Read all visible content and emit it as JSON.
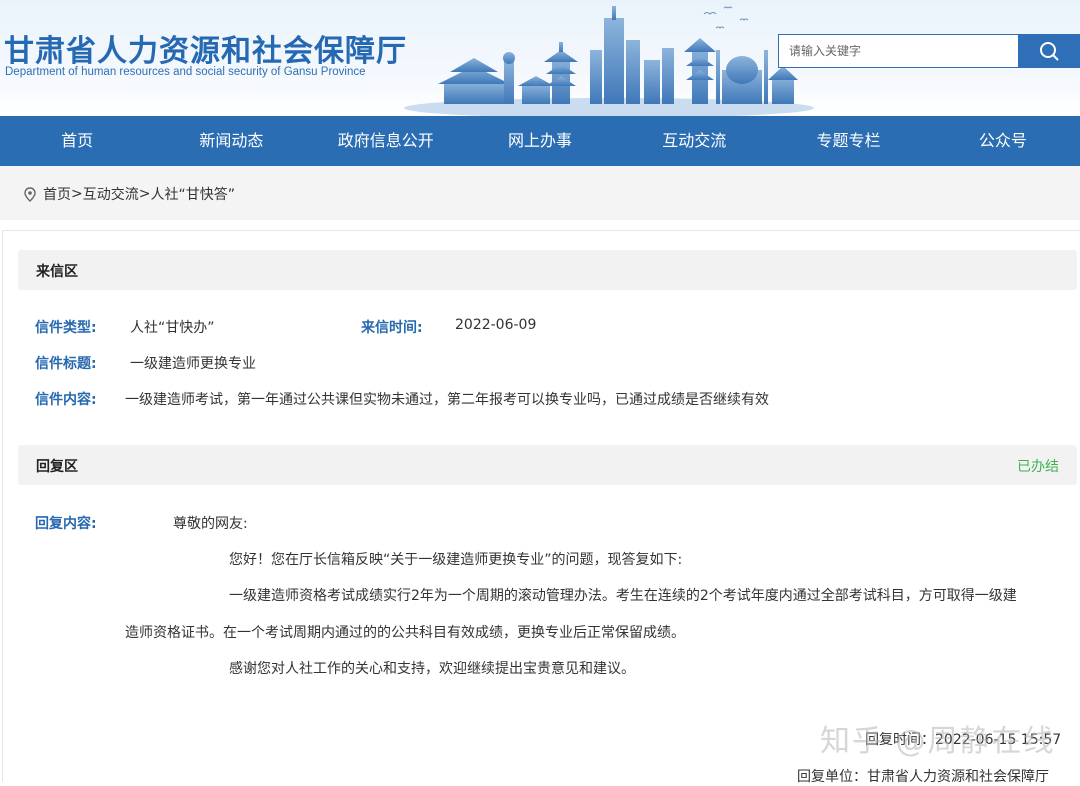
{
  "header": {
    "title": "甘肃省人力资源和社会保障厅",
    "subtitle": "Department of human resources and social security of Gansu Province",
    "search_placeholder": "请输入关键字",
    "search_icon": "search-icon"
  },
  "nav": {
    "items": [
      "首页",
      "新闻动态",
      "政府信息公开",
      "网上办事",
      "互动交流",
      "专题专栏",
      "公众号"
    ]
  },
  "breadcrumb": {
    "icon": "location-pin-icon",
    "items": [
      "首页",
      "互动交流",
      "人社“甘快答”"
    ],
    "separator": ">"
  },
  "letter": {
    "section_title": "来信区",
    "type_label": "信件类型:",
    "type_value": "人社“甘快办”",
    "time_label": "来信时间:",
    "time_value": "2022-06-09",
    "title_label": "信件标题:",
    "title_value": "一级建造师更换专业",
    "content_label": "信件内容:",
    "content_value": "一级建造师考试，第一年通过公共课但实物未通过，第二年报考可以换专业吗，已通过成绩是否继续有效"
  },
  "reply": {
    "section_title": "回复区",
    "status": "已办结",
    "content_label": "回复内容:",
    "greeting": "尊敬的网友:",
    "line1": "您好！您在厅长信箱反映“关于一级建造师更换专业”的问题，现答复如下:",
    "line2": "一级建造师资格考试成绩实行2年为一个周期的滚动管理办法。考生在连续的2个考试年度内通过全部考试科目，方可取得一级建",
    "line3": "造师资格证书。在一个考试周期内通过的的公共科目有效成绩，更换专业后正常保留成绩。",
    "line4": "感谢您对人社工作的关心和支持，欢迎继续提出宝贵意见和建议。",
    "time_text": "回复时间：2022-06-15 15:57",
    "unit_text": "回复单位：甘肃省人力资源和社会保障厅"
  },
  "watermark": "知乎 @周静在线",
  "colors": {
    "brand_blue": "#2a6db2",
    "label_blue": "#2769b0",
    "status_green": "#3fb34f"
  }
}
